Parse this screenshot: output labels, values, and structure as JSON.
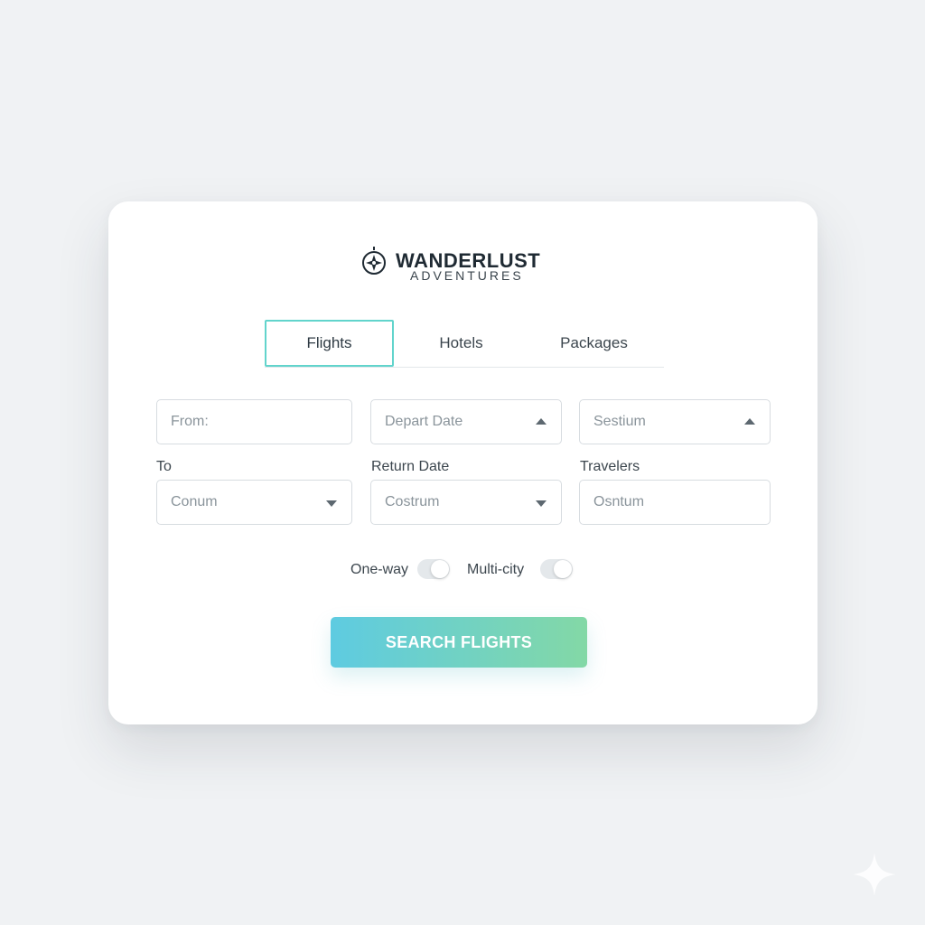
{
  "brand": {
    "name": "WANDERLUST",
    "subtitle": "ADVENTURES",
    "icon": "compass-icon"
  },
  "tabs": [
    {
      "label": "Flights",
      "active": true
    },
    {
      "label": "Hotels",
      "active": false
    },
    {
      "label": "Packages",
      "active": false
    }
  ],
  "fields": {
    "from": {
      "value": "From:"
    },
    "depart_date": {
      "value": "Depart Date",
      "icon": "caret-up-icon"
    },
    "third_top": {
      "value": "Sestium",
      "icon": "caret-up-icon"
    },
    "to": {
      "label": "To",
      "value": "Conum",
      "icon": "caret-down-icon"
    },
    "return_date": {
      "label": "Return Date",
      "value": "Costrum",
      "icon": "caret-down-icon"
    },
    "travelers": {
      "label": "Travelers",
      "value": "Osntum"
    }
  },
  "toggles": [
    {
      "label": "One-way",
      "on": false
    },
    {
      "label": "Multi-city",
      "on": false
    }
  ],
  "search_button": {
    "label": "SEARCH FLIGHTS"
  },
  "colors": {
    "background": "#f0f2f4",
    "card": "#ffffff",
    "active_tab_border": "#62d4cc",
    "button_gradient_start": "#5ecbe1",
    "button_gradient_end": "#83d8a6",
    "text_dark": "#1f2a33",
    "placeholder": "#8a949b"
  },
  "decoration": {
    "corner_icon": "sparkle-icon"
  }
}
